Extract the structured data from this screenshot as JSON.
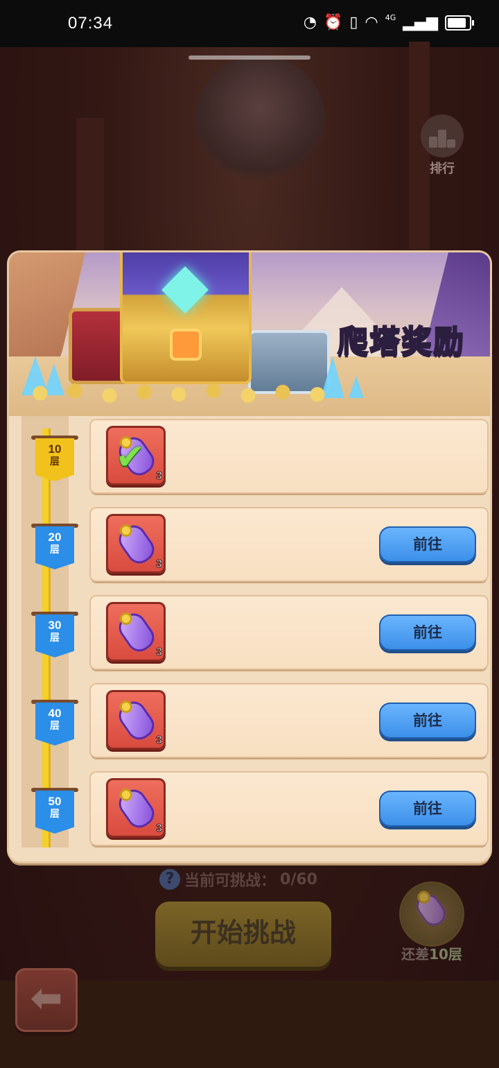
{
  "status_bar": {
    "time": "07:34",
    "network_label": "4G"
  },
  "top_right": {
    "ranking_label": "排行",
    "ranking_icon": "podium-icon"
  },
  "panel": {
    "title": "爬塔奖励",
    "floor_unit": "层",
    "rewards": [
      {
        "floor": "10",
        "quantity": "3",
        "claimed": true,
        "button_label": ""
      },
      {
        "floor": "20",
        "quantity": "3",
        "claimed": false,
        "button_label": "前往"
      },
      {
        "floor": "30",
        "quantity": "3",
        "claimed": false,
        "button_label": "前往"
      },
      {
        "floor": "40",
        "quantity": "3",
        "claimed": false,
        "button_label": "前往"
      },
      {
        "floor": "50",
        "quantity": "3",
        "claimed": false,
        "button_label": "前往"
      }
    ]
  },
  "bottom": {
    "challenge_label": "当前可挑战：",
    "challenge_count": "0/60",
    "start_button": "开始挑战",
    "next_reward_hint_prefix": "还差",
    "next_reward_hint_value": "10层",
    "back_icon": "arrow-left-icon"
  },
  "colors": {
    "accent_blue": "#3a8ee8",
    "gold": "#f2c21c",
    "panel": "#f2dcc0"
  }
}
